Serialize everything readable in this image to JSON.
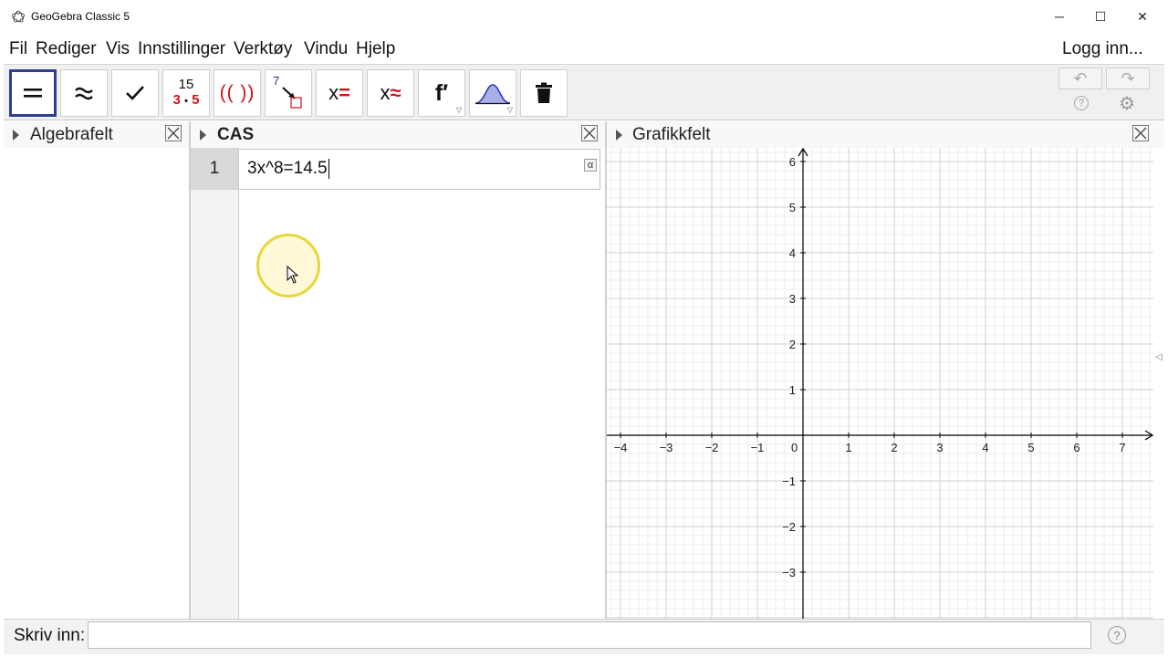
{
  "window": {
    "title": "GeoGebra Classic 5",
    "controls": {
      "minimize": "─",
      "maximize": "☐",
      "close": "✕"
    }
  },
  "menu": {
    "items": [
      "Fil",
      "Rediger",
      "Vis",
      "Innstillinger",
      "Verktøy",
      "Vindu",
      "Hjelp"
    ],
    "login": "Logg inn..."
  },
  "toolbar": {
    "tools": [
      {
        "name": "evaluate",
        "icon": "equals-icon"
      },
      {
        "name": "numeric",
        "icon": "approx-icon"
      },
      {
        "name": "keep-input",
        "icon": "check-icon"
      },
      {
        "name": "factor",
        "icon": "factor-icon",
        "top": "15",
        "bottom_a": "3",
        "bottom_dot": "•",
        "bottom_b": "5"
      },
      {
        "name": "expand",
        "icon": "expand-icon",
        "label": "(( ))"
      },
      {
        "name": "substitute",
        "icon": "substitute-icon",
        "sup": "7"
      },
      {
        "name": "solve",
        "icon": "solve-icon",
        "x": "x",
        "op": "="
      },
      {
        "name": "solve-numerically",
        "icon": "nsolve-icon",
        "x": "x",
        "op": "≈"
      },
      {
        "name": "derivative",
        "icon": "derivative-icon",
        "label": "f′"
      },
      {
        "name": "probability",
        "icon": "probability-curve-icon"
      },
      {
        "name": "delete",
        "icon": "trash-icon"
      }
    ],
    "undo": "↶",
    "redo": "↷",
    "help": "?",
    "settings": "⚙"
  },
  "panels": {
    "algebra": {
      "title": "Algebrafelt"
    },
    "cas": {
      "title": "CAS",
      "rows": [
        {
          "number": "1",
          "input": "3x^8=14.5"
        }
      ],
      "alpha": "α"
    },
    "graphics": {
      "title": "Grafikkfelt",
      "x_ticks": [
        "−4",
        "−3",
        "−2",
        "−1",
        "0",
        "1",
        "2",
        "3",
        "4",
        "5",
        "6",
        "7"
      ],
      "y_ticks": [
        "6",
        "5",
        "4",
        "3",
        "2",
        "1",
        "−1",
        "−2",
        "−3"
      ],
      "x_range": [
        -4.3,
        7.65
      ],
      "y_range": [
        -3.9,
        6.3
      ],
      "grid": true
    }
  },
  "input_bar": {
    "label": "Skriv inn:",
    "value": "",
    "help": "?"
  },
  "colors": {
    "accent": "#2e3f8f",
    "red": "#d0121b",
    "grid_minor": "#ececec",
    "grid_major": "#d2d2d2",
    "highlight": "#e8d63a"
  }
}
